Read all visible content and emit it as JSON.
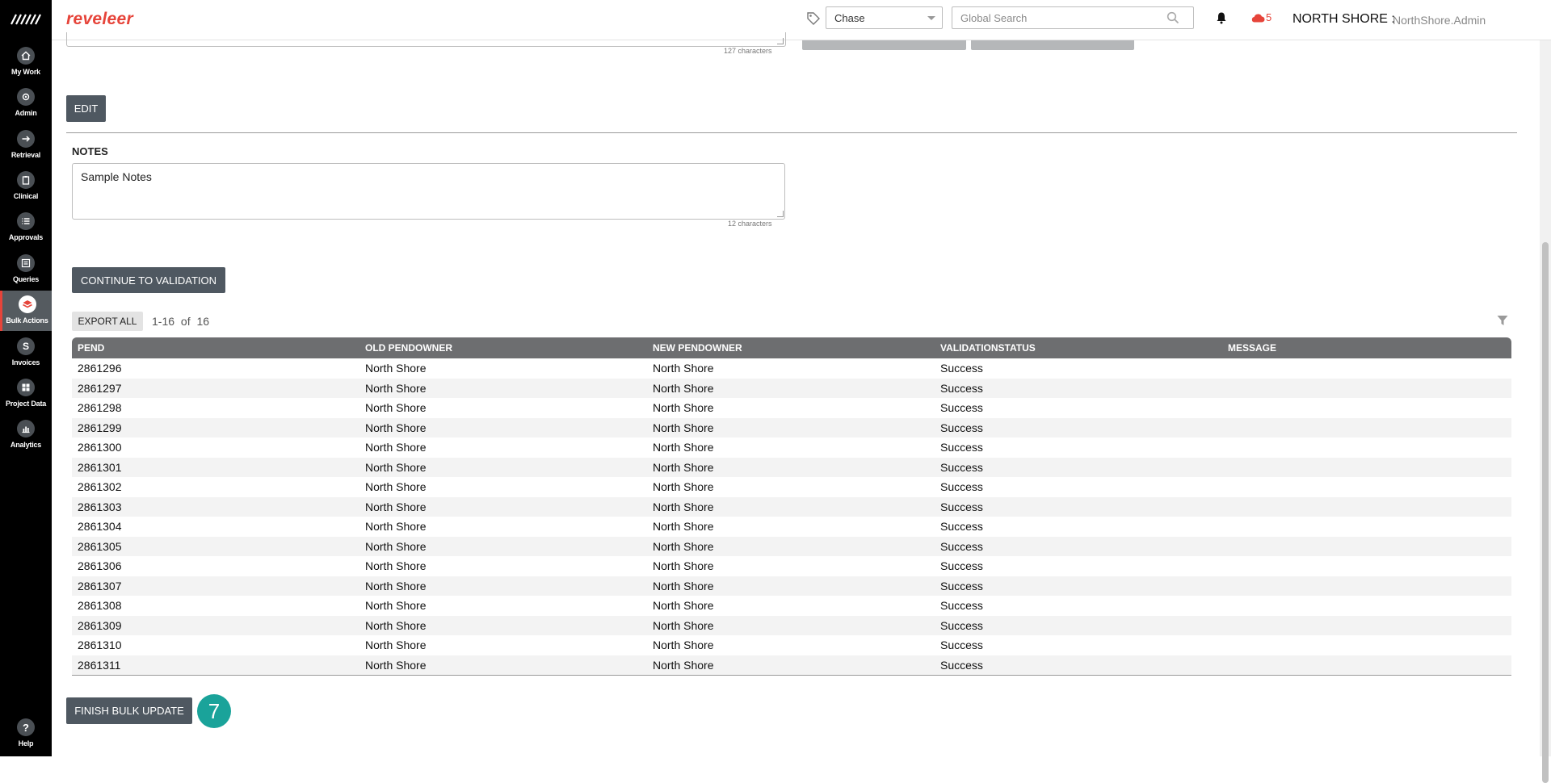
{
  "sidebar": {
    "items": [
      {
        "label": "My Work"
      },
      {
        "label": "Admin"
      },
      {
        "label": "Retrieval"
      },
      {
        "label": "Clinical"
      },
      {
        "label": "Approvals"
      },
      {
        "label": "Queries"
      },
      {
        "label": "Bulk Actions"
      },
      {
        "label": "Invoices"
      },
      {
        "label": "Project Data"
      },
      {
        "label": "Analytics"
      }
    ],
    "help_label": "Help",
    "invoice_glyph": "S",
    "help_glyph": "?"
  },
  "header": {
    "brand": "reveleer",
    "project_select": "Chase",
    "search_placeholder": "Global Search",
    "alert_count": "5",
    "org_name": "NORTH SHORE",
    "org_sep": ":",
    "user_name": "NorthShore.Admin"
  },
  "top_section": {
    "char_count": "127 characters"
  },
  "edit_button": "EDIT",
  "notes": {
    "label": "NOTES",
    "value": "Sample Notes",
    "char_count": "12 characters"
  },
  "continue_button": "CONTINUE TO VALIDATION",
  "grid": {
    "export_label": "EXPORT ALL",
    "pager_range": "1-16",
    "pager_of": "of",
    "pager_total": "16",
    "columns": [
      "PEND",
      "OLD PENDOWNER",
      "NEW PENDOWNER",
      "VALIDATIONSTATUS",
      "MESSAGE"
    ],
    "rows": [
      [
        "2861296",
        "North Shore",
        "North Shore",
        "Success",
        ""
      ],
      [
        "2861297",
        "North Shore",
        "North Shore",
        "Success",
        ""
      ],
      [
        "2861298",
        "North Shore",
        "North Shore",
        "Success",
        ""
      ],
      [
        "2861299",
        "North Shore",
        "North Shore",
        "Success",
        ""
      ],
      [
        "2861300",
        "North Shore",
        "North Shore",
        "Success",
        ""
      ],
      [
        "2861301",
        "North Shore",
        "North Shore",
        "Success",
        ""
      ],
      [
        "2861302",
        "North Shore",
        "North Shore",
        "Success",
        ""
      ],
      [
        "2861303",
        "North Shore",
        "North Shore",
        "Success",
        ""
      ],
      [
        "2861304",
        "North Shore",
        "North Shore",
        "Success",
        ""
      ],
      [
        "2861305",
        "North Shore",
        "North Shore",
        "Success",
        ""
      ],
      [
        "2861306",
        "North Shore",
        "North Shore",
        "Success",
        ""
      ],
      [
        "2861307",
        "North Shore",
        "North Shore",
        "Success",
        ""
      ],
      [
        "2861308",
        "North Shore",
        "North Shore",
        "Success",
        ""
      ],
      [
        "2861309",
        "North Shore",
        "North Shore",
        "Success",
        ""
      ],
      [
        "2861310",
        "North Shore",
        "North Shore",
        "Success",
        ""
      ],
      [
        "2861311",
        "North Shore",
        "North Shore",
        "Success",
        ""
      ]
    ]
  },
  "finish_button": "FINISH BULK UPDATE",
  "step_badge": "7",
  "colors": {
    "accent": "#e6443a",
    "button_dark": "#4f5861",
    "grid_header": "#6d6e70",
    "step_badge": "#1aa39a"
  },
  "icons": [
    "reveleer-logo-icon",
    "home-icon",
    "gear-icon",
    "arrow-right-icon",
    "clipboard-icon",
    "list-icon",
    "document-list-icon",
    "layers-icon",
    "dollar-icon",
    "grid-icon",
    "bar-chart-icon",
    "help-icon",
    "tag-icon",
    "search-icon",
    "bell-icon",
    "cloud-icon",
    "filter-icon",
    "chevron-down-icon"
  ]
}
